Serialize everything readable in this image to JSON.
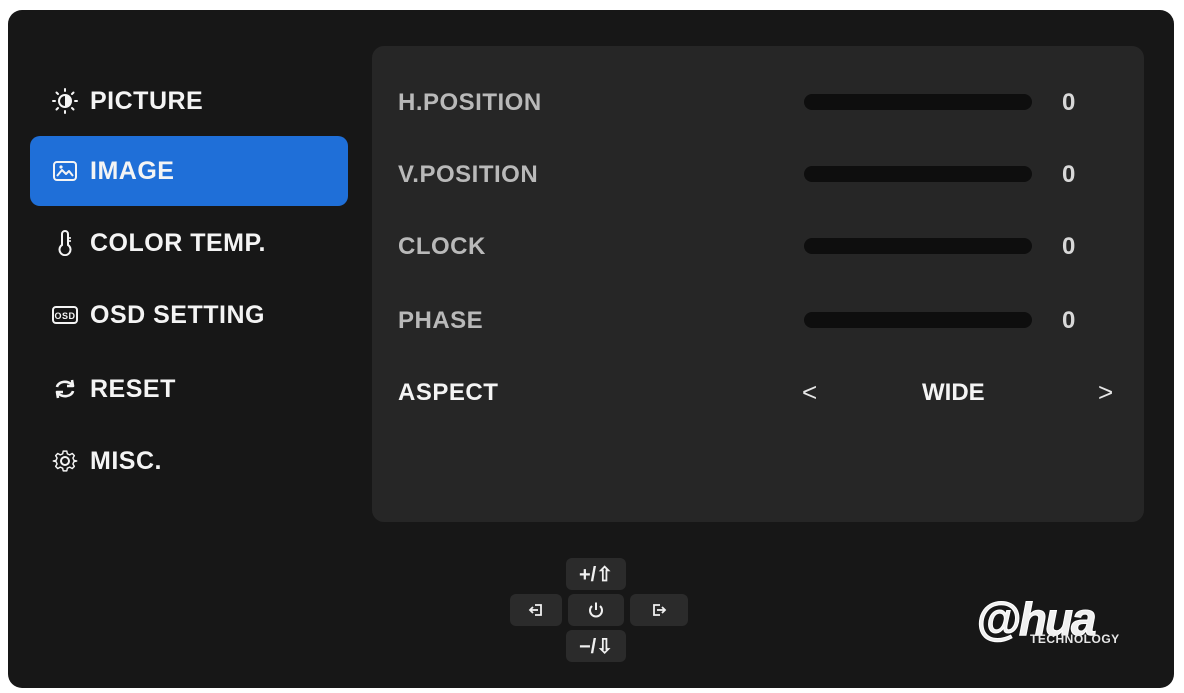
{
  "menu": {
    "items": [
      {
        "label": "PICTURE",
        "icon": "brightness-icon",
        "active": false
      },
      {
        "label": "IMAGE",
        "icon": "image-icon",
        "active": true
      },
      {
        "label": "COLOR TEMP.",
        "icon": "thermometer-icon",
        "active": false
      },
      {
        "label": "OSD SETTING",
        "icon": "osd-icon",
        "icon_text": "OSD",
        "active": false
      },
      {
        "label": "RESET",
        "icon": "reset-icon",
        "active": false
      },
      {
        "label": "MISC.",
        "icon": "gear-icon",
        "active": false
      }
    ]
  },
  "settings": {
    "h_position": {
      "label": "H.POSITION",
      "value": "0"
    },
    "v_position": {
      "label": "V.POSITION",
      "value": "0"
    },
    "clock": {
      "label": "CLOCK",
      "value": "0"
    },
    "phase": {
      "label": "PHASE",
      "value": "0"
    },
    "aspect": {
      "label": "ASPECT",
      "value": "WIDE",
      "prev": "<",
      "next": ">"
    }
  },
  "controls": {
    "up_label": "+/⇧",
    "down_label": "−/⇩"
  },
  "brand": {
    "logo_text": "@hua",
    "tagline": "TECHNOLOGY"
  },
  "colors": {
    "accent": "#1f6fd8",
    "background": "#171717",
    "panel": "#262626"
  }
}
